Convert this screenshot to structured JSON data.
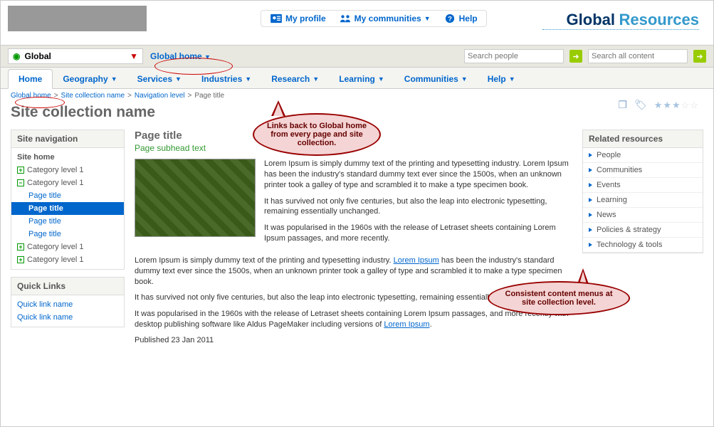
{
  "top_menu": {
    "profile": "My profile",
    "communities": "My communities",
    "help": "Help"
  },
  "brand": {
    "first": "Global",
    "second": "Resources"
  },
  "region": {
    "label": "Global",
    "home_link": "Global home"
  },
  "search": {
    "people_ph": "Search people",
    "content_ph": "Search all content"
  },
  "nav": [
    "Home",
    "Geography",
    "Services",
    "Industries",
    "Research",
    "Learning",
    "Communities",
    "Help"
  ],
  "crumbs": {
    "home": "Global home",
    "site": "Site collection name",
    "level": "Navigation level",
    "page": "Page title"
  },
  "site_title": "Site collection name",
  "sidebar": {
    "head": "Site navigation",
    "site_home": "Site home",
    "cat": "Category level 1",
    "pages": [
      "Page title",
      "Page title",
      "Page title",
      "Page title"
    ],
    "ql_head": "Quick Links",
    "ql": [
      "Quick link name",
      "Quick link name"
    ]
  },
  "main": {
    "title": "Page title",
    "subhead": "Page subhead text",
    "p1": "Lorem Ipsum is simply dummy text of the printing and typesetting industry. Lorem Ipsum has been the industry's standard dummy text ever since the 1500s, when an unknown printer took a galley of type and scrambled it to make a type specimen book.",
    "p2": "It has survived not only five centuries, but also the leap into electronic typesetting, remaining essentially unchanged.",
    "p3": "It was popularised in the 1960s with the release of Letraset sheets containing Lorem Ipsum passages, and more recently.",
    "p4a": "Lorem Ipsum is simply dummy text of the printing and typesetting industry. ",
    "p4link": "Lorem Ipsum",
    "p4b": " has been the industry's standard dummy text ever since the 1500s, when an unknown printer took a galley of type and scrambled it to make a type specimen book.",
    "p5": "It has survived not only five centuries, but also the leap into electronic typesetting, remaining essentially unchanged.",
    "p6a": "It was popularised in the 1960s with the release of Letraset sheets containing Lorem Ipsum passages, and more recently with desktop publishing software like Aldus PageMaker including versions of ",
    "p6link": "Lorem Ipsum",
    "p6b": ".",
    "published": "Published 23 Jan 2011"
  },
  "related": {
    "head": "Related resources",
    "items": [
      "People",
      "Communities",
      "Events",
      "Learning",
      "News",
      "Policies & strategy",
      "Technology & tools"
    ]
  },
  "callouts": {
    "c1": "Links back to Global home from every page and site collection.",
    "c2": "Consistent content menus at site collection level."
  }
}
